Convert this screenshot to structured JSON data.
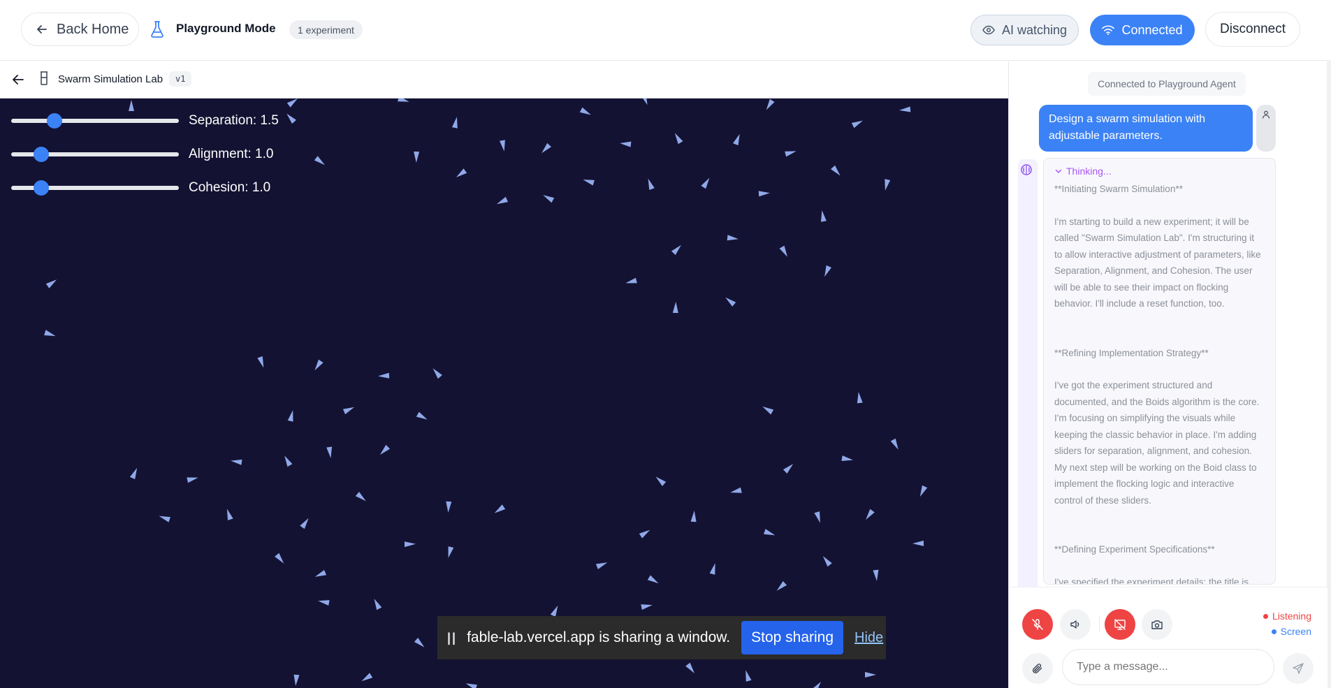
{
  "header": {
    "back_home_label": "Back Home",
    "mode_title": "Playground Mode",
    "experiment_count": "1 experiment",
    "ai_watching_label": "AI watching",
    "connected_label": "Connected",
    "disconnect_label": "Disconnect"
  },
  "subheader": {
    "title": "Swarm Simulation Lab",
    "version": "v1"
  },
  "controls": {
    "separation": {
      "label": "Separation: 1.5",
      "value": 1.5,
      "fraction": 0.26
    },
    "alignment": {
      "label": "Alignment: 1.0",
      "value": 1.0,
      "fraction": 0.18
    },
    "cohesion": {
      "label": "Cohesion: 1.0",
      "value": 1.0,
      "fraction": 0.18
    }
  },
  "share_bar": {
    "pause_glyph": "||",
    "message": "fable-lab.vercel.app is sharing a window.",
    "stop_label": "Stop sharing",
    "hide_label": "Hide"
  },
  "chat": {
    "connection_note": "Connected to Playground Agent",
    "user_message": "Design a swarm simulation with adjustable parameters.",
    "thinking_label": "Thinking...",
    "thinking_paragraphs": [
      "**Initiating Swarm Simulation**",
      "I'm starting to build a new experiment; it will be called \"Swarm Simulation Lab\". I'm structuring it to allow interactive adjustment of parameters, like Separation, Alignment, and Cohesion. The user will be able to see their impact on flocking behavior. I'll include a reset function, too.",
      "**Refining Implementation Strategy**",
      "I've got the experiment structured and documented, and the Boids algorithm is the core. I'm focusing on simplifying the visuals while keeping the classic behavior in place. I'm adding sliders for separation, alignment, and cohesion. My next step will be working on the Boid class to implement the flocking logic and interactive control of these sliders.",
      "**Defining Experiment Specifications**",
      "I've specified the experiment details: the title is \"Swarm Simulation Lab\" and the description clearly"
    ],
    "status_listening": "Listening",
    "status_screen": "Screen",
    "input_placeholder": "Type a message..."
  },
  "colors": {
    "accent": "#3b82f6",
    "canvas_bg": "#141232",
    "boid": "#8fa8e8",
    "danger": "#ef4444",
    "thinking": "#a855f7"
  },
  "icons": [
    "arrow-left-icon",
    "beaker-icon",
    "eye-icon",
    "wifi-icon",
    "brain-icon",
    "user-icon",
    "chevron-down-icon",
    "mic-off-icon",
    "volume-icon",
    "screen-share-off-icon",
    "camera-icon",
    "paperclip-icon",
    "send-icon"
  ]
}
